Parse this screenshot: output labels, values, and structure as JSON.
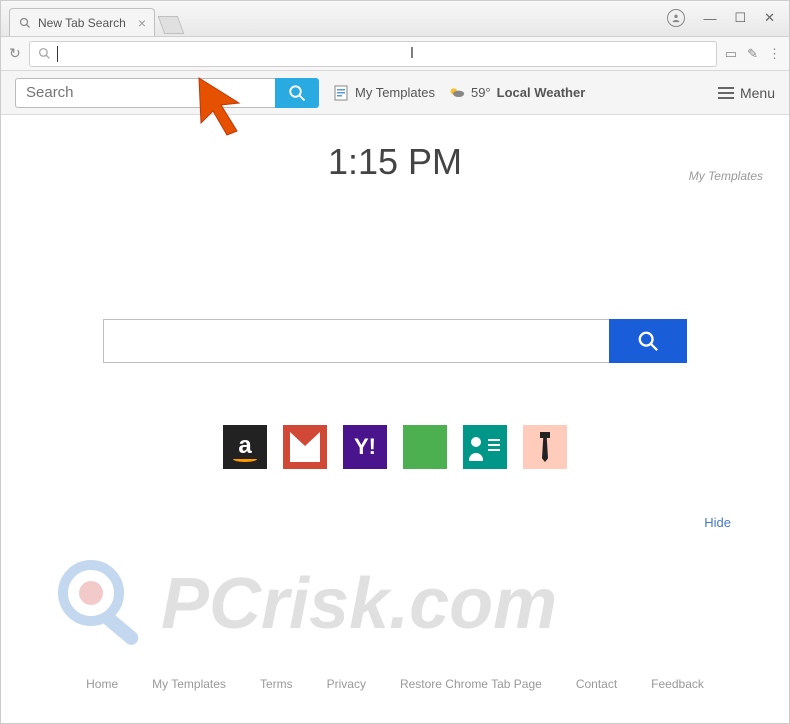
{
  "browser": {
    "tab_title": "New Tab Search",
    "window_controls": {
      "minimize": "—",
      "maximize": "☐",
      "close": "✕"
    }
  },
  "toolbar": {
    "search_placeholder": "Search",
    "my_templates": "My Templates",
    "weather_temp": "59°",
    "weather_label": "Local Weather",
    "menu_label": "Menu"
  },
  "page": {
    "clock": "1:15 PM",
    "templates_link": "My Templates",
    "hide_label": "Hide"
  },
  "shortcuts": {
    "amazon_letter": "a",
    "yahoo_letter": "Y!"
  },
  "footer": {
    "home": "Home",
    "my_templates": "My Templates",
    "terms": "Terms",
    "privacy": "Privacy",
    "restore": "Restore Chrome Tab Page",
    "contact": "Contact",
    "feedback": "Feedback"
  },
  "watermark": {
    "text": "PCrisk.com"
  }
}
